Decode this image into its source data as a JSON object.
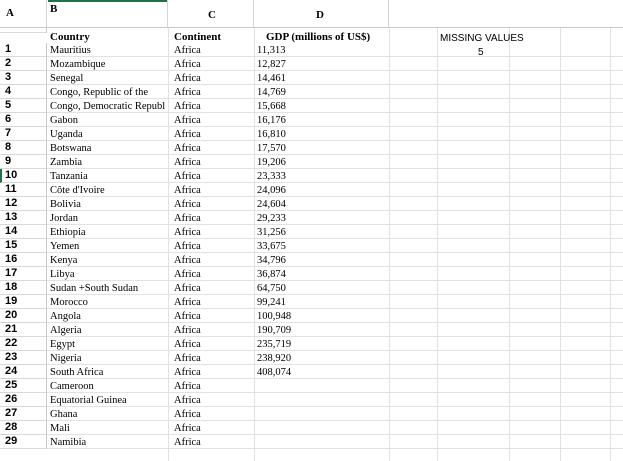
{
  "columns": {
    "a": "A",
    "b": "B",
    "c": "C",
    "d": "D"
  },
  "headers": {
    "country": "Country",
    "continent": "Continent",
    "gdp": "GDP (millions of US$)"
  },
  "missing": {
    "label": "MISSING VALUES",
    "value": "5"
  },
  "rows": [
    {
      "n": "1",
      "country": "Mauritius",
      "continent": "Africa",
      "gdp": "11,313"
    },
    {
      "n": "2",
      "country": "Mozambique",
      "continent": "Africa",
      "gdp": "12,827"
    },
    {
      "n": "3",
      "country": "Senegal",
      "continent": "Africa",
      "gdp": "14,461"
    },
    {
      "n": "4",
      "country": "Congo, Republic of the",
      "continent": "Africa",
      "gdp": "14,769"
    },
    {
      "n": "5",
      "country": "Congo, Democratic Republ",
      "continent": "Africa",
      "gdp": "15,668"
    },
    {
      "n": "6",
      "country": "Gabon",
      "continent": "Africa",
      "gdp": "16,176"
    },
    {
      "n": "7",
      "country": "Uganda",
      "continent": "Africa",
      "gdp": "16,810"
    },
    {
      "n": "8",
      "country": "Botswana",
      "continent": "Africa",
      "gdp": "17,570"
    },
    {
      "n": "9",
      "country": "Zambia",
      "continent": "Africa",
      "gdp": "19,206"
    },
    {
      "n": "10",
      "country": "Tanzania",
      "continent": "Africa",
      "gdp": "23,333"
    },
    {
      "n": "11",
      "country": "Côte d'Ivoire",
      "continent": "Africa",
      "gdp": "24,096"
    },
    {
      "n": "12",
      "country": "Bolivia",
      "continent": "Africa",
      "gdp": "24,604"
    },
    {
      "n": "13",
      "country": "Jordan",
      "continent": "Africa",
      "gdp": "29,233"
    },
    {
      "n": "14",
      "country": "Ethiopia",
      "continent": "Africa",
      "gdp": "31,256"
    },
    {
      "n": "15",
      "country": "Yemen",
      "continent": "Africa",
      "gdp": "33,675"
    },
    {
      "n": "16",
      "country": "Kenya",
      "continent": "Africa",
      "gdp": "34,796"
    },
    {
      "n": "17",
      "country": "Libya",
      "continent": "Africa",
      "gdp": "36,874"
    },
    {
      "n": "18",
      "country": "Sudan +South Sudan",
      "continent": "Africa",
      "gdp": "64,750"
    },
    {
      "n": "19",
      "country": "Morocco",
      "continent": "Africa",
      "gdp": "99,241"
    },
    {
      "n": "20",
      "country": "Angola",
      "continent": "Africa",
      "gdp": "100,948"
    },
    {
      "n": "21",
      "country": "Algeria",
      "continent": "Africa",
      "gdp": "190,709"
    },
    {
      "n": "22",
      "country": "Egypt",
      "continent": "Africa",
      "gdp": "235,719"
    },
    {
      "n": "23",
      "country": "Nigeria",
      "continent": "Africa",
      "gdp": "238,920"
    },
    {
      "n": "24",
      "country": "South Africa",
      "continent": "Africa",
      "gdp": "408,074"
    },
    {
      "n": "25",
      "country": "Cameroon",
      "continent": "Africa",
      "gdp": ""
    },
    {
      "n": "26",
      "country": "Equatorial Guinea",
      "continent": "Africa",
      "gdp": ""
    },
    {
      "n": "27",
      "country": "Ghana",
      "continent": "Africa",
      "gdp": ""
    },
    {
      "n": "28",
      "country": "Mali",
      "continent": "Africa",
      "gdp": ""
    },
    {
      "n": "29",
      "country": "Namibia",
      "continent": "Africa",
      "gdp": ""
    }
  ]
}
